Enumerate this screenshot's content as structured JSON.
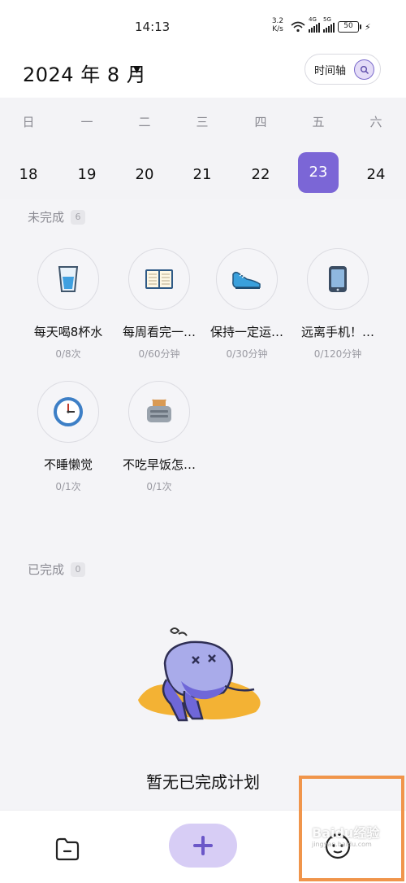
{
  "status_bar": {
    "time": "14:13",
    "net_speed_value": "3.2",
    "net_speed_unit": "K/s",
    "signal1_tag": "4G",
    "signal2_tag": "5G",
    "battery": "50"
  },
  "header": {
    "month_title": "2024 年 8 月",
    "timeline_label": "时间轴"
  },
  "week": {
    "weekdays": [
      "日",
      "一",
      "二",
      "三",
      "四",
      "五",
      "六"
    ],
    "dates": [
      "18",
      "19",
      "20",
      "21",
      "22",
      "23",
      "24"
    ],
    "selected_date": "23"
  },
  "incomplete": {
    "label": "未完成",
    "count": "6",
    "habits": [
      {
        "name": "每天喝8杯水",
        "progress": "0/8次",
        "icon": "water-glass-icon"
      },
      {
        "name": "每周看完一…",
        "progress": "0/60分钟",
        "icon": "book-icon"
      },
      {
        "name": "保持一定运…",
        "progress": "0/30分钟",
        "icon": "sneaker-icon"
      },
      {
        "name": "远离手机！…",
        "progress": "0/120分钟",
        "icon": "phone-icon"
      },
      {
        "name": "不睡懒觉",
        "progress": "0/1次",
        "icon": "clock-icon"
      },
      {
        "name": "不吃早饭怎…",
        "progress": "0/1次",
        "icon": "toaster-icon"
      }
    ]
  },
  "completed": {
    "label": "已完成",
    "count": "0",
    "empty_text": "暂无已完成计划"
  },
  "watermark": {
    "main": "Baidu经验",
    "sub": "jingyan.baidu.com"
  },
  "colors": {
    "accent": "#7b66d6",
    "add_button": "#d7cdf5",
    "highlight": "#f0954b"
  }
}
